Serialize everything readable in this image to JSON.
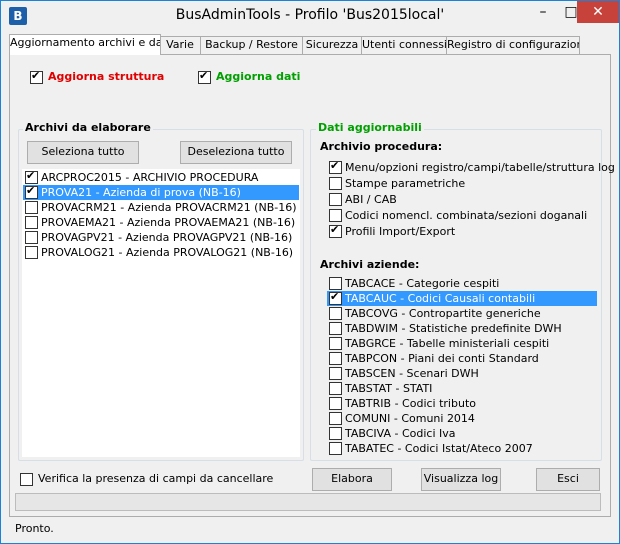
{
  "window": {
    "title": "BusAdminTools - Profilo 'Bus2015local'",
    "icon": "B",
    "min": "–",
    "max": "□",
    "close": "✕"
  },
  "tabs": [
    {
      "label": "Aggiornamento archivi e dati",
      "active": true
    },
    {
      "label": "Varie",
      "active": false
    },
    {
      "label": "Backup / Restore",
      "active": false
    },
    {
      "label": "Sicurezza",
      "active": false
    },
    {
      "label": "Utenti connessi",
      "active": false
    },
    {
      "label": "Registro di configurazione",
      "active": false
    }
  ],
  "top_options": {
    "aggiorna_struttura": {
      "label": "Aggiorna struttura",
      "checked": true,
      "color": "#e00000"
    },
    "aggiorna_dati": {
      "label": "Aggiorna dati",
      "checked": true,
      "color": "#00a000"
    }
  },
  "archivi": {
    "title": "Archivi da elaborare",
    "select_all": "Seleziona tutto",
    "deselect_all": "Deseleziona tutto",
    "items": [
      {
        "label": "ARCPROC2015 - ARCHIVIO PROCEDURA",
        "checked": true,
        "selected": false
      },
      {
        "label": "PROVA21 - Azienda di prova (NB-16)",
        "checked": true,
        "selected": true
      },
      {
        "label": "PROVACRM21 - Azienda PROVACRM21 (NB-16)",
        "checked": false,
        "selected": false
      },
      {
        "label": "PROVAEMA21 - Azienda PROVAEMA21 (NB-16)",
        "checked": false,
        "selected": false
      },
      {
        "label": "PROVAGPV21 - Azienda PROVAGPV21 (NB-16)",
        "checked": false,
        "selected": false
      },
      {
        "label": "PROVALOG21 - Azienda PROVALOG21 (NB-16)",
        "checked": false,
        "selected": false
      }
    ]
  },
  "dati": {
    "title": "Dati aggiornabili",
    "title_color": "#00a000",
    "procedura_label": "Archivio procedura:",
    "procedura_items": [
      {
        "label": "Menu/opzioni registro/campi/tabelle/struttura log",
        "checked": true
      },
      {
        "label": "Stampe parametriche",
        "checked": false
      },
      {
        "label": "ABI / CAB",
        "checked": false
      },
      {
        "label": "Codici nomencl. combinata/sezioni doganali",
        "checked": false
      },
      {
        "label": "Profili Import/Export",
        "checked": true
      }
    ],
    "aziende_label": "Archivi aziende:",
    "aziende_items": [
      {
        "label": "TABCACE - Categorie cespiti",
        "checked": false,
        "selected": false
      },
      {
        "label": "TABCAUC - Codici Causali contabili",
        "checked": true,
        "selected": true
      },
      {
        "label": "TABCOVG - Contropartite generiche",
        "checked": false,
        "selected": false
      },
      {
        "label": "TABDWIM - Statistiche predefinite DWH",
        "checked": false,
        "selected": false
      },
      {
        "label": "TABGRCE - Tabelle ministeriali cespiti",
        "checked": false,
        "selected": false
      },
      {
        "label": "TABPCON - Piani dei conti Standard",
        "checked": false,
        "selected": false
      },
      {
        "label": "TABSCEN - Scenari DWH",
        "checked": false,
        "selected": false
      },
      {
        "label": "TABSTAT - STATI",
        "checked": false,
        "selected": false
      },
      {
        "label": "TABTRIB - Codici tributo",
        "checked": false,
        "selected": false
      },
      {
        "label": "COMUNI - Comuni 2014",
        "checked": false,
        "selected": false
      },
      {
        "label": "TABCIVA - Codici Iva",
        "checked": false,
        "selected": false
      },
      {
        "label": "TABATEC - Codici Istat/Ateco 2007",
        "checked": false,
        "selected": false
      }
    ]
  },
  "bottom": {
    "verifica_label": "Verifica la presenza di campi da cancellare",
    "verifica_checked": false,
    "elabora": "Elabora",
    "visualizza_log": "Visualizza log",
    "esci": "Esci"
  },
  "progress": {
    "value": 0
  },
  "status": "Pronto."
}
